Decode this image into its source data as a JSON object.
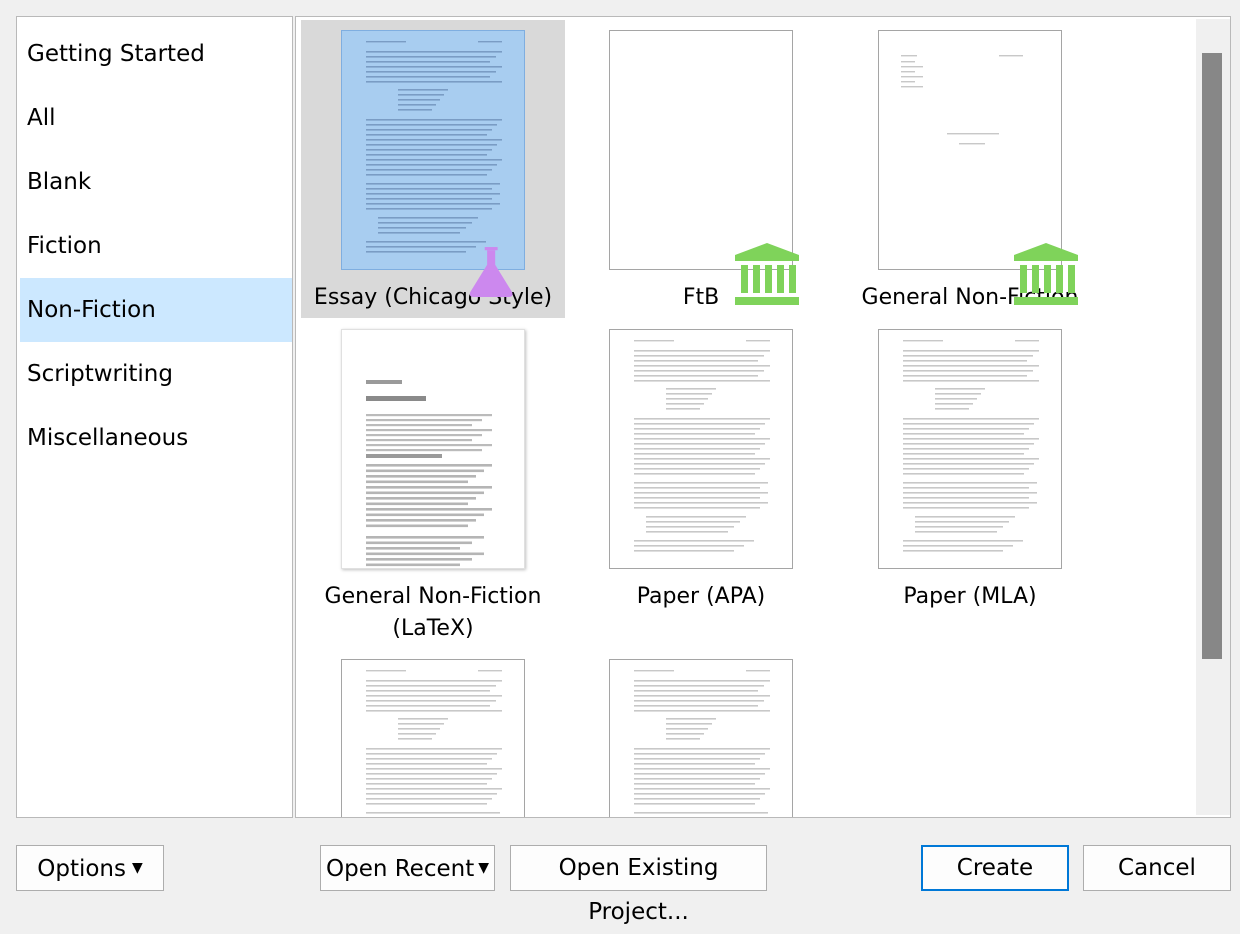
{
  "sidebar": {
    "categories": [
      {
        "label": "Getting Started"
      },
      {
        "label": "All"
      },
      {
        "label": "Blank"
      },
      {
        "label": "Fiction"
      },
      {
        "label": "Non-Fiction",
        "selected": true
      },
      {
        "label": "Scriptwriting"
      },
      {
        "label": "Miscellaneous"
      }
    ]
  },
  "templates": [
    {
      "label": "Essay (Chicago Style)",
      "icon": "graduation-cap-icon",
      "selected": true
    },
    {
      "label": "FtB",
      "icon": null
    },
    {
      "label": "General Non-Fiction",
      "icon": "open-book-icon"
    },
    {
      "label": "General Non-Fiction (LaTeX)",
      "icon": "flask-icon"
    },
    {
      "label": "Paper (APA)",
      "icon": "institution-icon"
    },
    {
      "label": "Paper (MLA)",
      "icon": "institution-icon"
    },
    {
      "label": "",
      "icon": null
    },
    {
      "label": "",
      "icon": null
    }
  ],
  "buttons": {
    "options": "Options",
    "open_recent": "Open Recent",
    "open_existing": "Open Existing Project...",
    "create": "Create",
    "cancel": "Cancel"
  },
  "colors": {
    "selection": "#cce8ff",
    "cap": "#4a90d9",
    "book": "#3ea6f0",
    "flask": "#cc88ee",
    "institution": "#7fd35a"
  }
}
